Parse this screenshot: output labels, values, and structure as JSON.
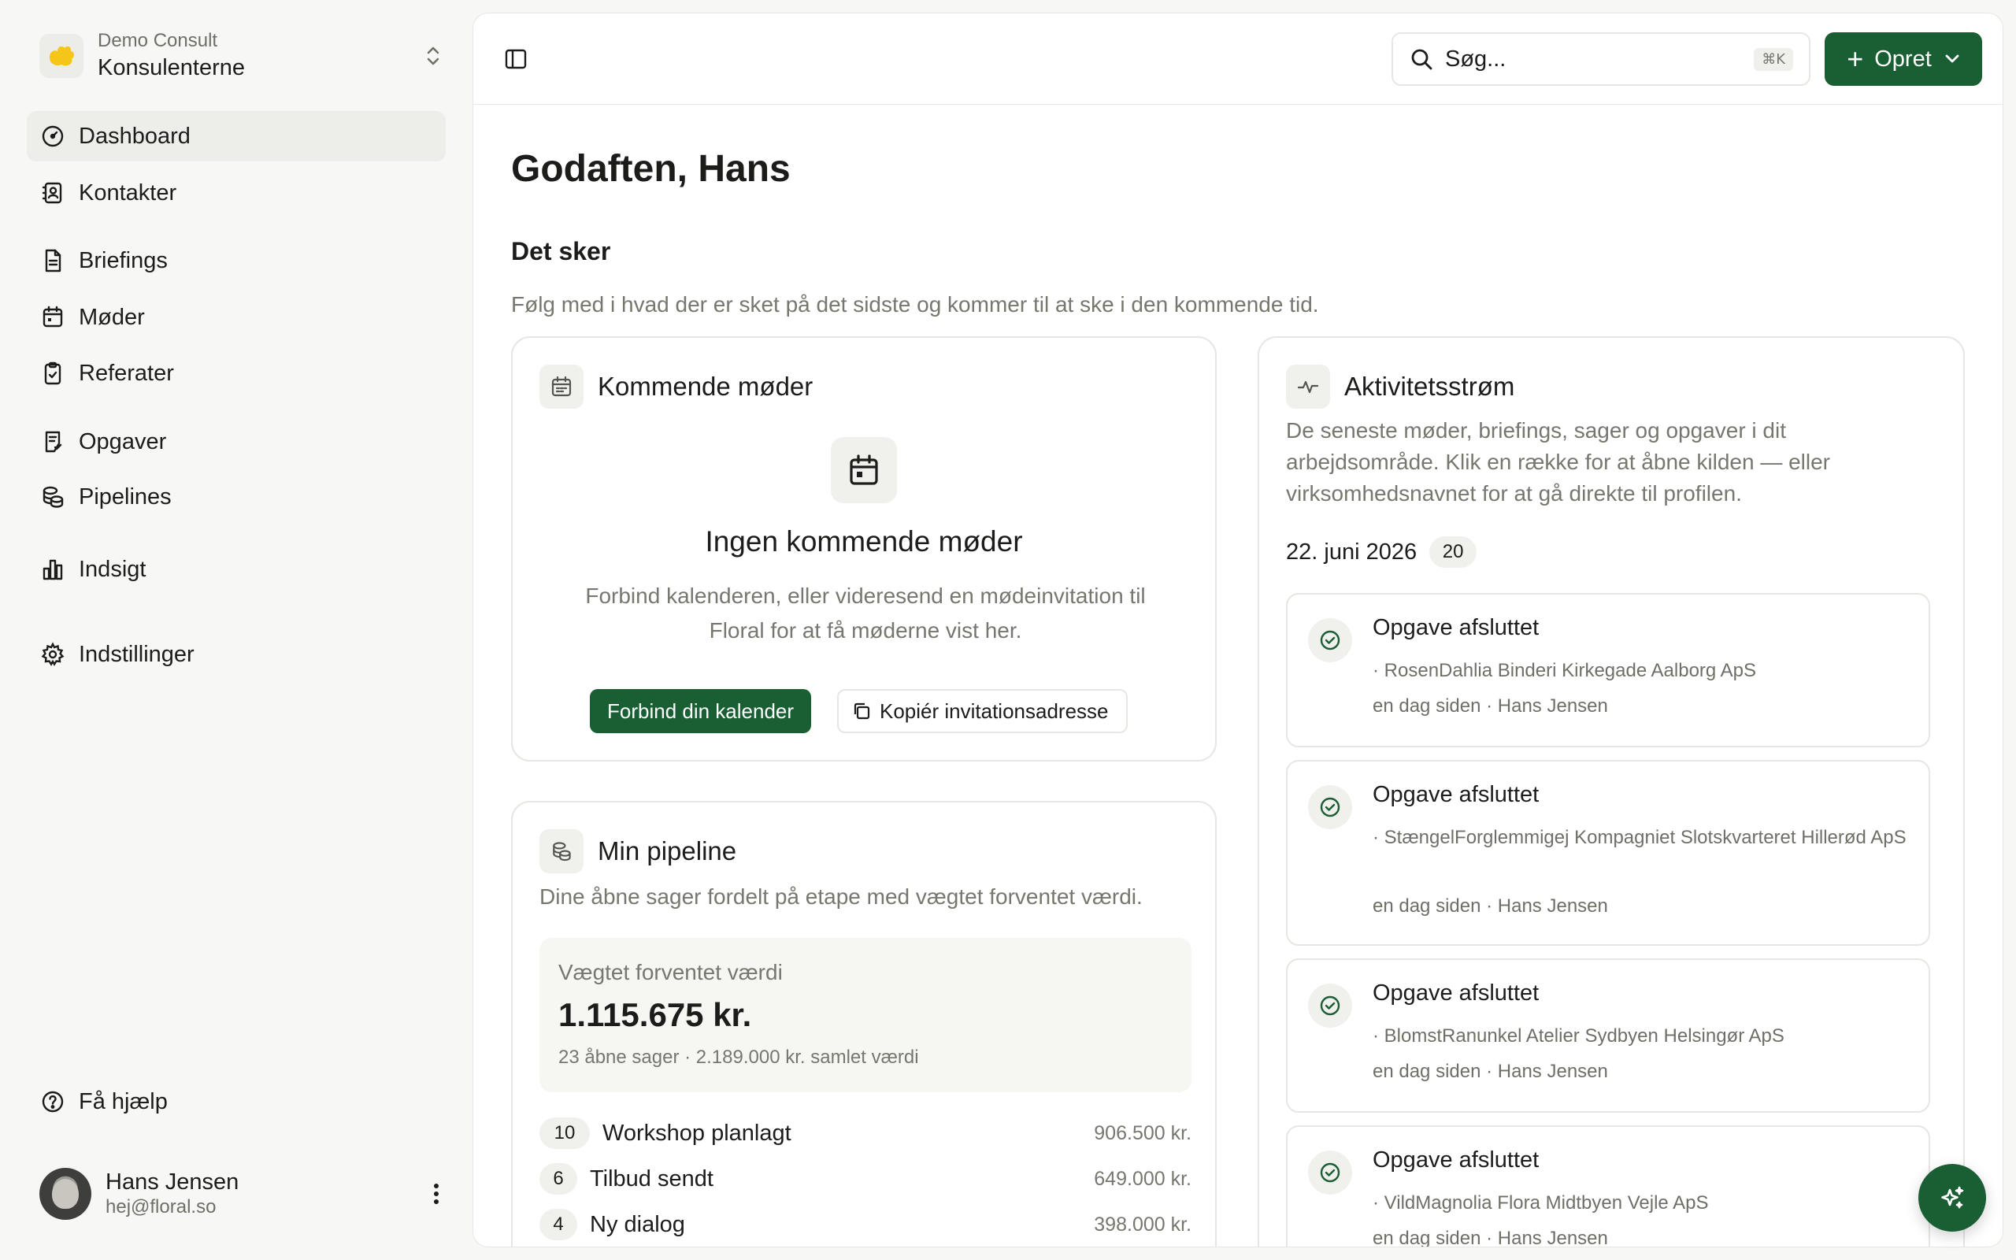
{
  "org": {
    "sub_label": "Demo Consult",
    "name": "Konsulenterne"
  },
  "nav": [
    {
      "label": "Dashboard",
      "icon": "gauge-icon"
    },
    {
      "label": "Kontakter",
      "icon": "contact-book-icon"
    },
    {
      "label": "Briefings",
      "icon": "document-icon"
    },
    {
      "label": "Møder",
      "icon": "calendar-icon"
    },
    {
      "label": "Referater",
      "icon": "clipboard-check-icon"
    },
    {
      "label": "Opgaver",
      "icon": "task-list-icon"
    },
    {
      "label": "Pipelines",
      "icon": "coins-icon"
    },
    {
      "label": "Indsigt",
      "icon": "bar-chart-icon"
    },
    {
      "label": "Indstillinger",
      "icon": "gear-icon"
    }
  ],
  "help_label": "Få hjælp",
  "user": {
    "name": "Hans Jensen",
    "email": "hej@floral.so"
  },
  "topbar": {
    "search_placeholder": "Søg...",
    "search_shortcut": "⌘K",
    "create_label": "Opret"
  },
  "greeting": "Godaften, Hans",
  "section": {
    "title": "Det sker",
    "description": "Følg med i hvad der er sket på det sidste og kommer til at ske i den kommende tid."
  },
  "meetings": {
    "title": "Kommende møder",
    "empty_title": "Ingen kommende møder",
    "empty_desc": "Forbind kalenderen, eller videresend en mødeinvitation til Floral for at få møderne vist her.",
    "connect_label": "Forbind din kalender",
    "copy_label": "Kopiér invitationsadresse"
  },
  "pipeline": {
    "title": "Min pipeline",
    "description": "Dine åbne sager fordelt på etape med vægtet forventet værdi.",
    "weighted_label": "Vægtet forventet værdi",
    "weighted_value": "1.115.675 kr.",
    "summary": "23 åbne sager · 2.189.000 kr. samlet værdi",
    "stages": [
      {
        "count": "10",
        "name": "Workshop planlagt",
        "value": "906.500 kr."
      },
      {
        "count": "6",
        "name": "Tilbud sendt",
        "value": "649.000 kr."
      },
      {
        "count": "4",
        "name": "Ny dialog",
        "value": "398.000 kr."
      }
    ]
  },
  "activity": {
    "title": "Aktivitetsstrøm",
    "description": "De seneste møder, briefings, sager og opgaver i dit arbejdsområde. Klik en række for at åbne kilden — eller virksomhedsnavnet for at gå direkte til profilen.",
    "date": "22. juni 2026",
    "date_count": "20",
    "items": [
      {
        "title": "Opgave afsluttet",
        "company": "· RosenDahlia Binderi Kirkegade Aalborg ApS",
        "meta": "en dag siden · Hans Jensen"
      },
      {
        "title": "Opgave afsluttet",
        "company": "· StængelForglemmigej Kompagniet Slotskvarteret Hillerød ApS",
        "meta": "en dag siden · Hans Jensen"
      },
      {
        "title": "Opgave afsluttet",
        "company": "· BlomstRanunkel Atelier Sydbyen Helsingør ApS",
        "meta": "en dag siden · Hans Jensen"
      },
      {
        "title": "Opgave afsluttet",
        "company": "· VildMagnolia Flora Midtbyen Vejle ApS",
        "meta": "en dag siden · Hans Jensen"
      }
    ]
  },
  "colors": {
    "accent": "#1a5e33",
    "logo": "#f5c518",
    "muted_text": "#77776f"
  }
}
